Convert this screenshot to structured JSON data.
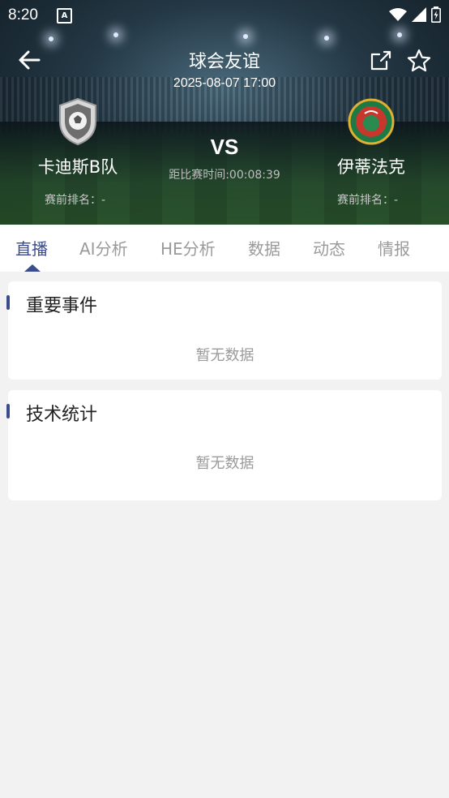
{
  "status": {
    "time": "8:20",
    "notification_icon": "A"
  },
  "header": {
    "title": "球会友谊",
    "datetime": "2025-08-07 17:00",
    "vs": "VS",
    "countdown": "距比赛时间:00:08:39",
    "home": {
      "name": "卡迪斯B队",
      "rank": "赛前排名：-"
    },
    "away": {
      "name": "伊蒂法克",
      "rank": "赛前排名：-"
    }
  },
  "tabs": [
    {
      "label": "直播"
    },
    {
      "label": "AI分析"
    },
    {
      "label": "HE分析"
    },
    {
      "label": "数据"
    },
    {
      "label": "动态"
    },
    {
      "label": "情报"
    }
  ],
  "sections": [
    {
      "title": "重要事件",
      "empty": "暂无数据"
    },
    {
      "title": "技术统计",
      "empty": "暂无数据"
    }
  ],
  "colors": {
    "accent": "#3b4c8c"
  }
}
